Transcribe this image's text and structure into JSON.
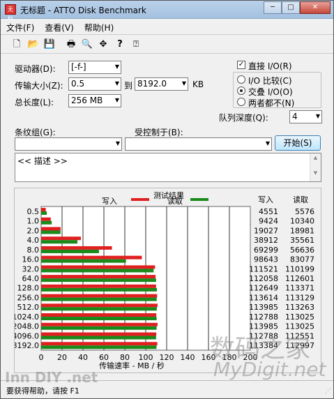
{
  "window": {
    "title": "无标题 - ATTO Disk Benchmark",
    "icon_text": "无标",
    "controls": {
      "minimize": "─",
      "maximize": "□",
      "close": "✕"
    }
  },
  "menu": [
    {
      "label": "文件(F)"
    },
    {
      "label": "查看(V)"
    },
    {
      "label": "帮助(H)"
    }
  ],
  "toolbar": {
    "icons": [
      "new-document-icon",
      "open-folder-icon",
      "save-icon",
      "print-icon",
      "print-preview-icon",
      "move-icon",
      "help-icon",
      "context-help-icon"
    ],
    "glyphs": [
      "🗋",
      "📂",
      "💾",
      "🖶",
      "🔍",
      "✥",
      "?",
      "⍰"
    ]
  },
  "settings": {
    "drive_label": "驱动器(D):",
    "drive_value": "[-f-]",
    "transfer_label": "传输大小(Z):",
    "transfer_from": "0.5",
    "transfer_to_label": "到",
    "transfer_to": "8192.0",
    "transfer_unit": "KB",
    "length_label": "总长度(L):",
    "length_value": "256 MB",
    "direct_io_label": "直接 I/O(R)",
    "direct_io_checked": true,
    "radio_compare": "I/O 比较(C)",
    "radio_overlap": "交叠 I/O(O)",
    "radio_neither": "两者都不(N)",
    "selected_radio": "overlap",
    "queue_label": "队列深度(Q):",
    "queue_value": "4",
    "stripe_label": "条纹组(G):",
    "stripe_value": "",
    "controlled_label": "受控制于(B):",
    "controlled_value": "",
    "start_button": "开始(S)",
    "description": "<< 描述 >>"
  },
  "chart_data": {
    "type": "bar",
    "title": "测试结果",
    "legend": [
      {
        "name": "写入",
        "color": "#e02020"
      },
      {
        "name": "读取",
        "color": "#1a8a1a"
      }
    ],
    "xlabel": "传输速率 - MB / 秒",
    "xlim": [
      0,
      200
    ],
    "xticks": [
      0,
      20,
      40,
      60,
      80,
      100,
      120,
      140,
      160,
      180,
      200
    ],
    "grid": true,
    "categories": [
      "0.5",
      "1.0",
      "2.0",
      "4.0",
      "8.0",
      "16.0",
      "32.0",
      "64.0",
      "128.0",
      "256.0",
      "512.0",
      "1024.0",
      "2048.0",
      "4096.0",
      "8192.0"
    ],
    "series": [
      {
        "name": "写入",
        "color": "#e02020",
        "values": [
          4.4,
          9.2,
          18.6,
          38.0,
          67.7,
          96.3,
          108.9,
          109.4,
          109.9,
          110.9,
          111.3,
          110.1,
          111.3,
          110.1,
          111.1
        ]
      },
      {
        "name": "读取",
        "color": "#1a8a1a",
        "values": [
          5.4,
          10.1,
          18.5,
          34.7,
          55.3,
          81.1,
          107.5,
          109.9,
          110.7,
          110.5,
          110.6,
          110.4,
          110.4,
          109.9,
          110.3
        ]
      }
    ],
    "table_headers": [
      "写入",
      "读取"
    ],
    "table_rows": [
      [
        "4551",
        "5576"
      ],
      [
        "9424",
        "10340"
      ],
      [
        "19027",
        "18981"
      ],
      [
        "38912",
        "35561"
      ],
      [
        "69299",
        "56636"
      ],
      [
        "98643",
        "83077"
      ],
      [
        "111521",
        "110199"
      ],
      [
        "112058",
        "112601"
      ],
      [
        "112649",
        "113371"
      ],
      [
        "113614",
        "113129"
      ],
      [
        "113985",
        "113263"
      ],
      [
        "112788",
        "113025"
      ],
      [
        "113985",
        "113025"
      ],
      [
        "112788",
        "112551"
      ],
      [
        "113384",
        "112997"
      ]
    ]
  },
  "status": {
    "text": "要获得帮助，请按 F1"
  },
  "watermark": {
    "cn": "数码之家",
    "en": "MyDigit.net",
    "corner": "Inn DIY .net"
  }
}
